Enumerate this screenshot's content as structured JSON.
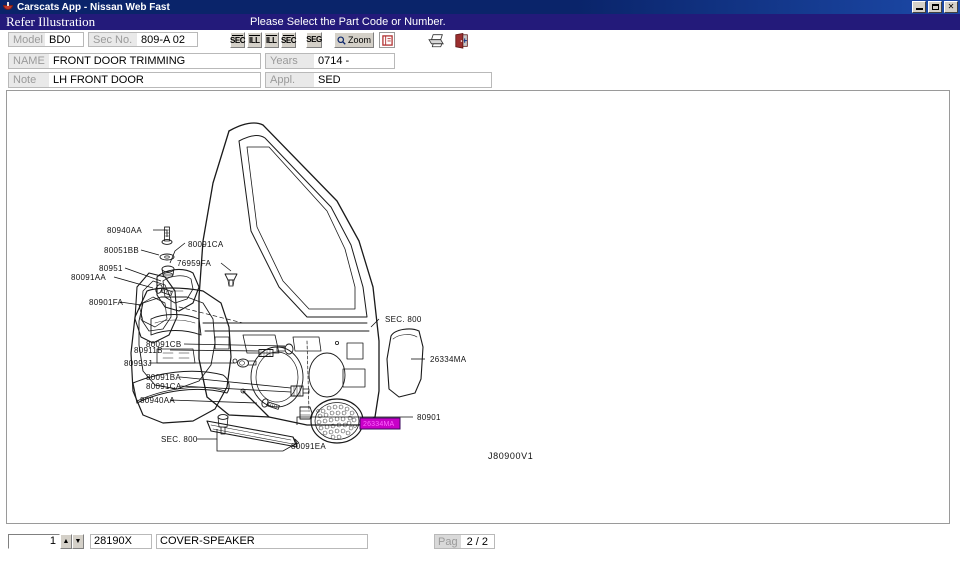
{
  "window": {
    "title": "Carscats App - Nissan Web Fast",
    "icon": "app-icon",
    "minimize_label": "_",
    "maximize_label": "□",
    "close_label": "✕"
  },
  "header": {
    "screen_title": "Refer Illustration",
    "prompt": "Please Select the Part Code or Number."
  },
  "form": {
    "model": {
      "label": "Model",
      "value": "BD0"
    },
    "sec_no": {
      "label": "Sec No.",
      "value": "809-A 02"
    },
    "name": {
      "label": "NAME",
      "value": "FRONT DOOR TRIMMING"
    },
    "years": {
      "label": "Years",
      "value": "0714 -"
    },
    "note": {
      "label": "Note",
      "value": "LH FRONT DOOR"
    },
    "appl": {
      "label": "Appl.",
      "value": "SED"
    }
  },
  "toolbar": {
    "buttons": [
      {
        "name": "sec-first-button",
        "label": "SEC",
        "icon": "sec-first-icon"
      },
      {
        "name": "ill-prev-button",
        "label": "ILL",
        "icon": "ill-prev-icon"
      },
      {
        "name": "ill-next-button",
        "label": "ILL",
        "icon": "ill-next-icon"
      },
      {
        "name": "sec-last-button",
        "label": "SEC",
        "icon": "sec-last-icon"
      },
      {
        "name": "seg-button",
        "label": "SEG",
        "icon": "seg-icon"
      },
      {
        "name": "zoom-button",
        "label": "Zoom",
        "icon": "zoom-icon"
      },
      {
        "name": "legend-button",
        "label": "",
        "icon": "legend-icon"
      },
      {
        "name": "print-button",
        "label": "",
        "icon": "printer-icon"
      },
      {
        "name": "exit-button",
        "label": "",
        "icon": "exit-door-icon"
      }
    ]
  },
  "illustration": {
    "drawing_id": "J80900V1",
    "highlighted_part": "26334MA",
    "callouts": [
      "80940AA",
      "80091CA",
      "80051BB",
      "76959FA",
      "80951",
      "80091AA",
      "80901FA",
      "80091CB",
      "80911B",
      "80993J",
      "80091BA",
      "80091CA",
      "80940AA",
      "SEC. 800",
      "80091EA",
      "SEC. 800",
      "26334MA",
      "80901"
    ]
  },
  "footer": {
    "quantity": "1",
    "spin_up": "▲",
    "spin_down": "▼",
    "part_code": "28190X",
    "part_description": "COVER-SPEAKER",
    "page_label": "Pag",
    "page_value": "2 / 2"
  },
  "colors": {
    "titlebar": "#0a246a",
    "headerbar": "#231a7a",
    "highlight": "#c800c8",
    "field_label": "#9a9a9a"
  }
}
